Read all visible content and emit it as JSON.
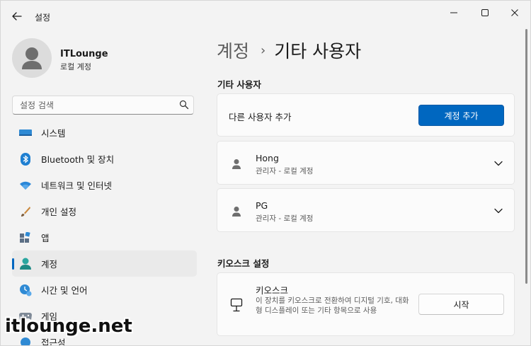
{
  "window": {
    "title": "설정",
    "accent_color": "#0067c0"
  },
  "profile": {
    "name": "ITLounge",
    "account_type": "로컬 계정"
  },
  "search": {
    "placeholder": "설정 검색"
  },
  "sidebar": {
    "items": [
      {
        "label": "시스템",
        "icon": "display-icon"
      },
      {
        "label": "Bluetooth 및 장치",
        "icon": "bluetooth-icon"
      },
      {
        "label": "네트워크 및 인터넷",
        "icon": "wifi-icon"
      },
      {
        "label": "개인 설정",
        "icon": "brush-icon"
      },
      {
        "label": "앱",
        "icon": "apps-icon"
      },
      {
        "label": "계정",
        "icon": "account-icon",
        "active": true
      },
      {
        "label": "시간 및 언어",
        "icon": "clock-globe-icon"
      },
      {
        "label": "게임",
        "icon": "gamepad-icon"
      },
      {
        "label": "접근성",
        "icon": "accessibility-icon"
      }
    ]
  },
  "breadcrumb": {
    "parent": "계정",
    "separator": "›",
    "current": "기타 사용자"
  },
  "other_users": {
    "section_title": "기타 사용자",
    "add_label": "다른 사용자 추가",
    "add_button": "계정 추가",
    "users": [
      {
        "name": "Hong",
        "role": "관리자 - 로컬 계정"
      },
      {
        "name": "PG",
        "role": "관리자 - 로컬 계정"
      }
    ]
  },
  "kiosk": {
    "section_title": "키오스크 설정",
    "title": "키오스크",
    "description": "이 장치를 키오스크로 전환하여 디지털 기호, 대화형 디스플레이 또는 기타 항목으로 사용",
    "button": "시작"
  },
  "watermark": "itlounge.net"
}
